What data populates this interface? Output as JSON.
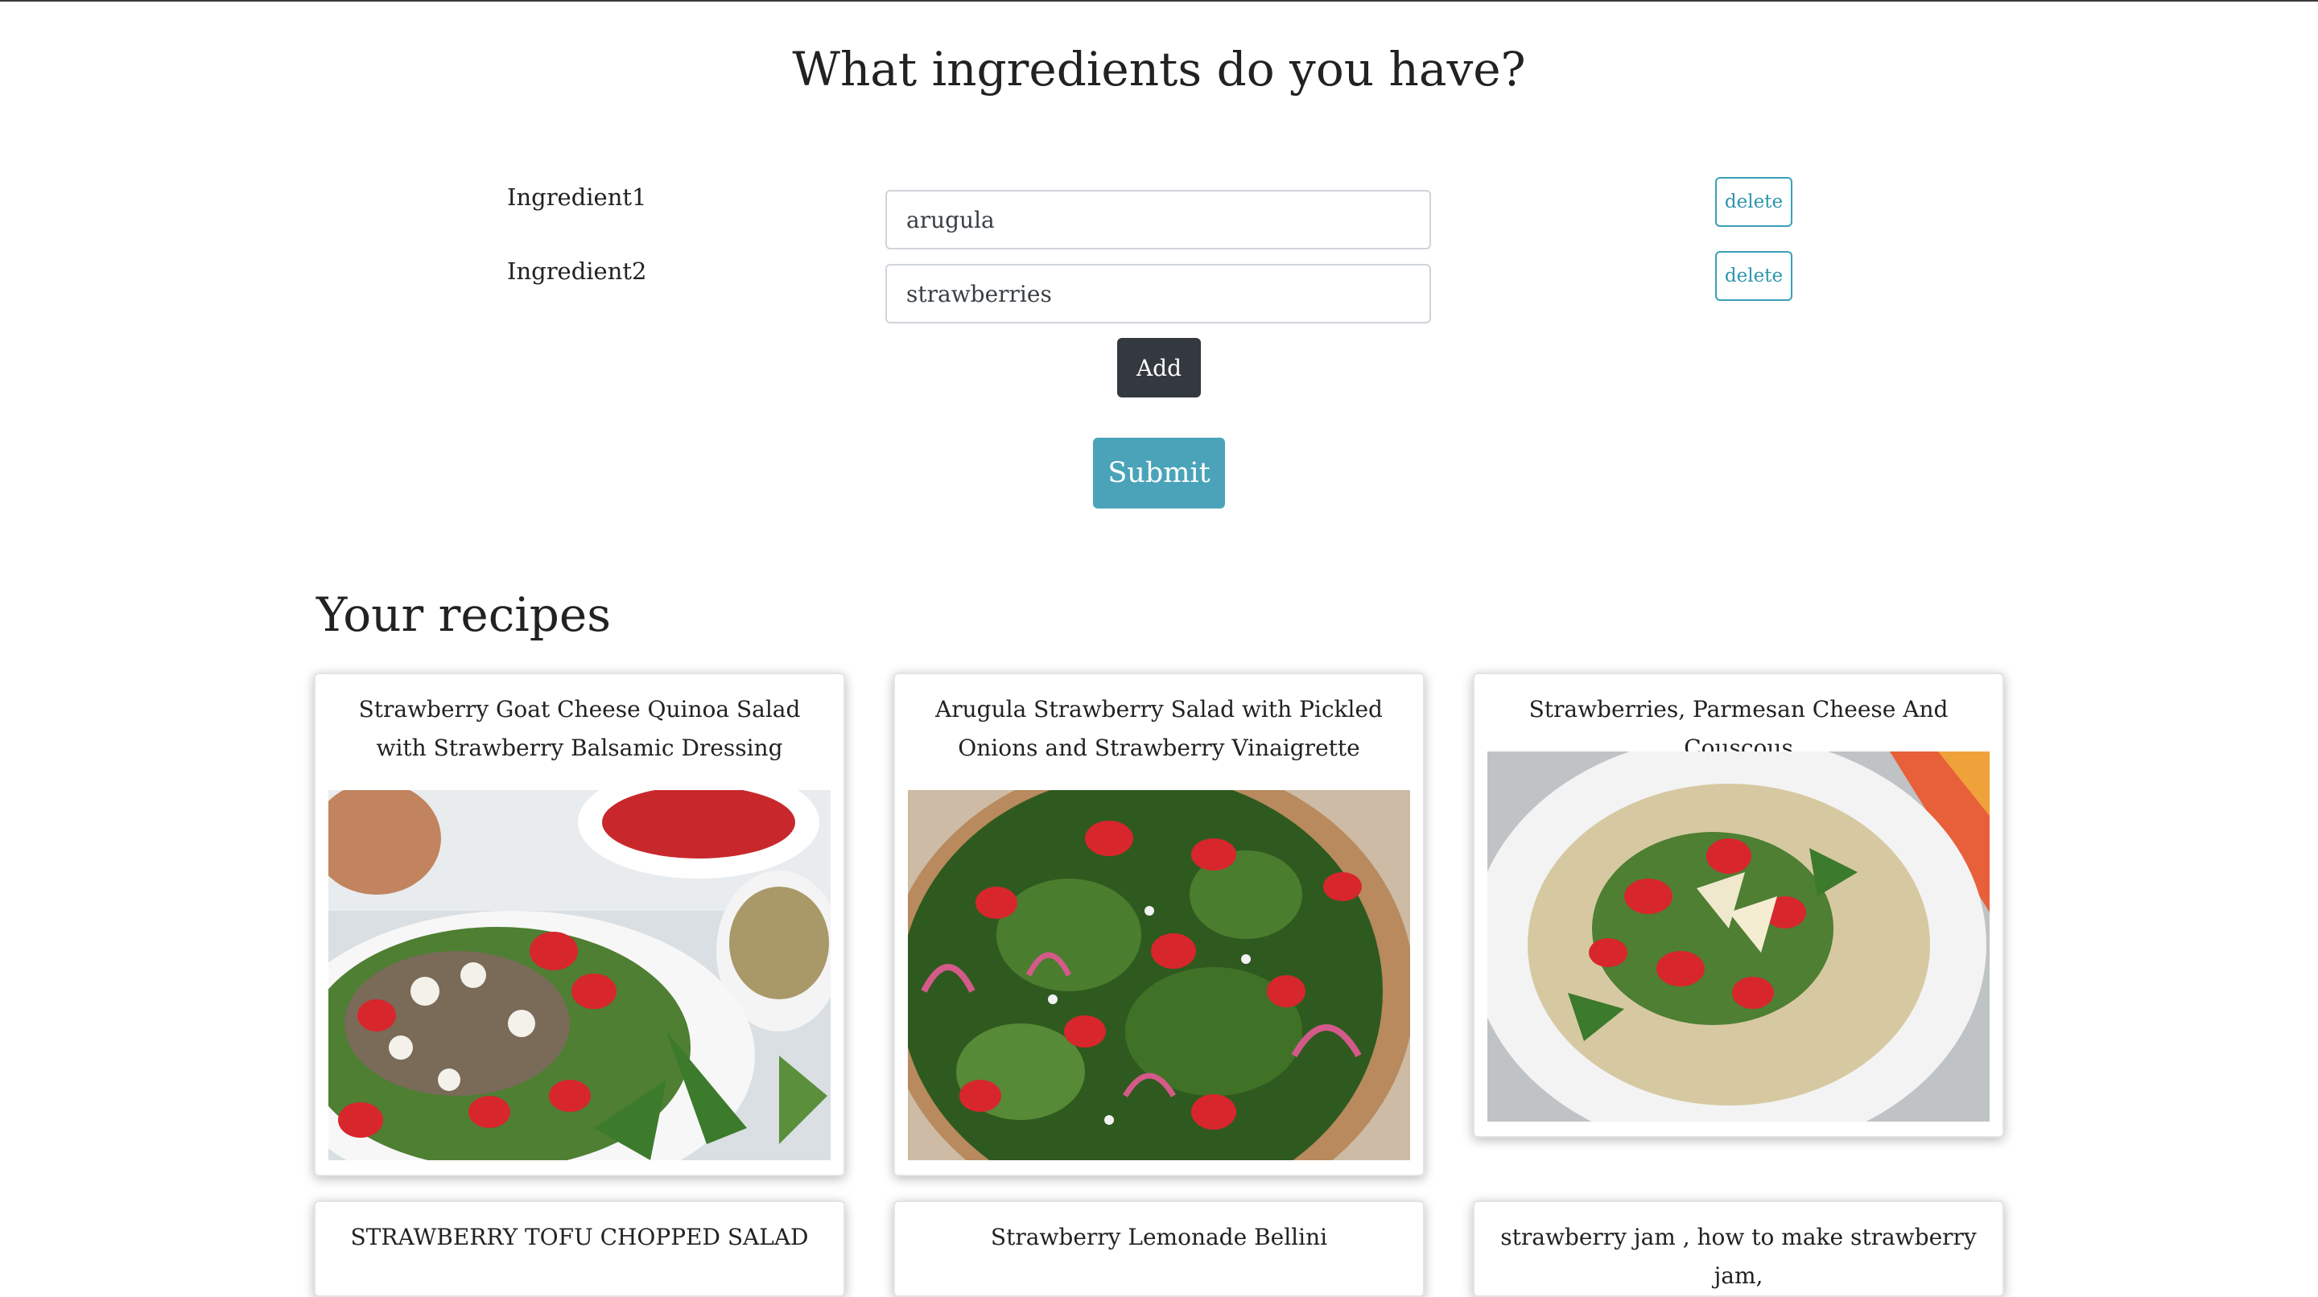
{
  "page": {
    "title": "What ingredients do you have?"
  },
  "ingredients": [
    {
      "label": "Ingredient1",
      "value": "arugula",
      "delete_label": "delete"
    },
    {
      "label": "Ingredient2",
      "value": "strawberries",
      "delete_label": "delete"
    }
  ],
  "actions": {
    "add_label": "Add",
    "submit_label": "Submit"
  },
  "recipes_section": {
    "title": "Your recipes"
  },
  "recipes": [
    {
      "title": "Strawberry Goat Cheese Quinoa Salad with Strawberry Balsamic Dressing"
    },
    {
      "title": "Arugula Strawberry Salad with Pickled Onions and Strawberry Vinaigrette"
    },
    {
      "title": "Strawberries, Parmesan Cheese And Couscous"
    },
    {
      "title": "STRAWBERRY TOFU CHOPPED SALAD"
    },
    {
      "title": "Strawberry Lemonade Bellini"
    },
    {
      "title": "strawberry jam , how to make strawberry jam,"
    }
  ],
  "colors": {
    "primary_dark": "#33393f",
    "info": "#4aa3b9",
    "outline_info": "#2c96ad",
    "strawberry": "#d8262d",
    "arugula": "#3c7a2c"
  }
}
